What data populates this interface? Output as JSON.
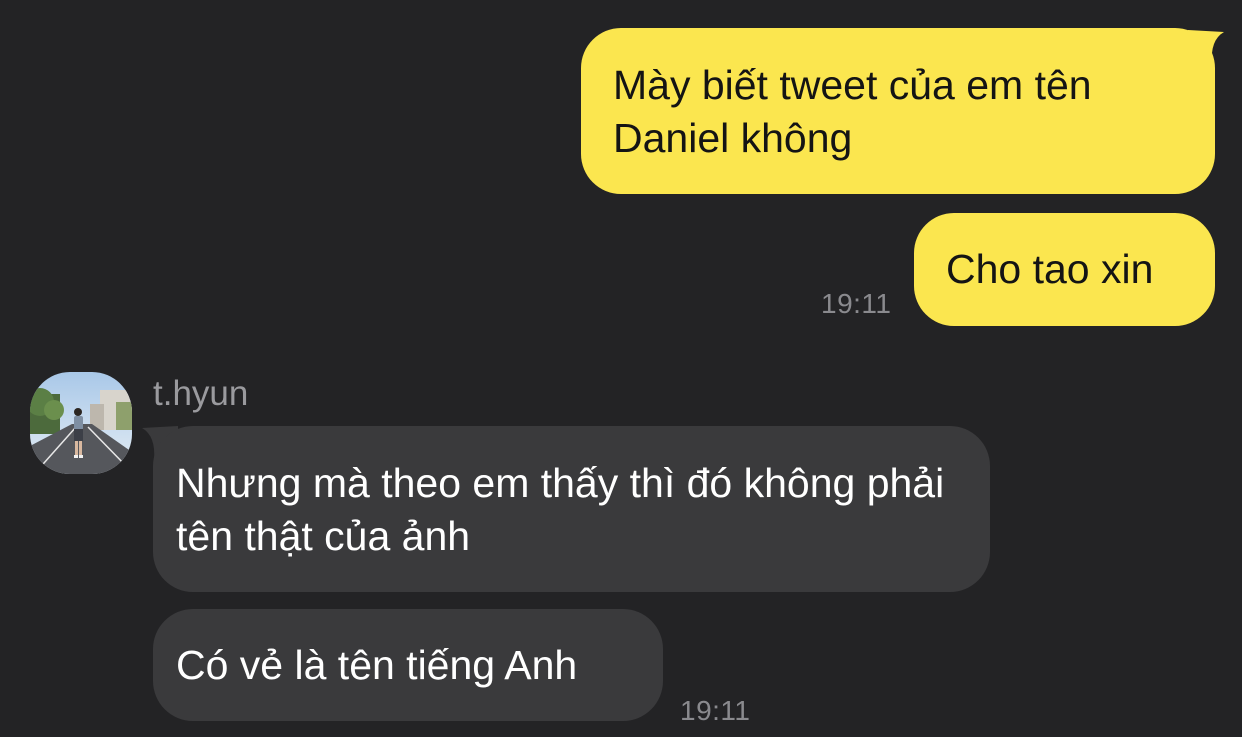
{
  "conversation": {
    "outgoing": [
      {
        "text": "Mày biết tweet của em tên Daniel không"
      },
      {
        "text": "Cho tao xin",
        "time": "19:11"
      }
    ],
    "contact": {
      "name": "t.hyun",
      "avatar_icon": "avatar-photo-person-on-street"
    },
    "incoming": [
      {
        "text": "Nhưng mà theo em thấy thì đó không phải tên thật của ảnh"
      },
      {
        "text": "Có vẻ là tên tiếng Anh",
        "time": "19:11"
      }
    ]
  },
  "colors": {
    "background": "#232325",
    "outgoing_bubble": "#fbe64f",
    "incoming_bubble": "#3a3a3c",
    "timestamp": "#8a8a8e"
  }
}
